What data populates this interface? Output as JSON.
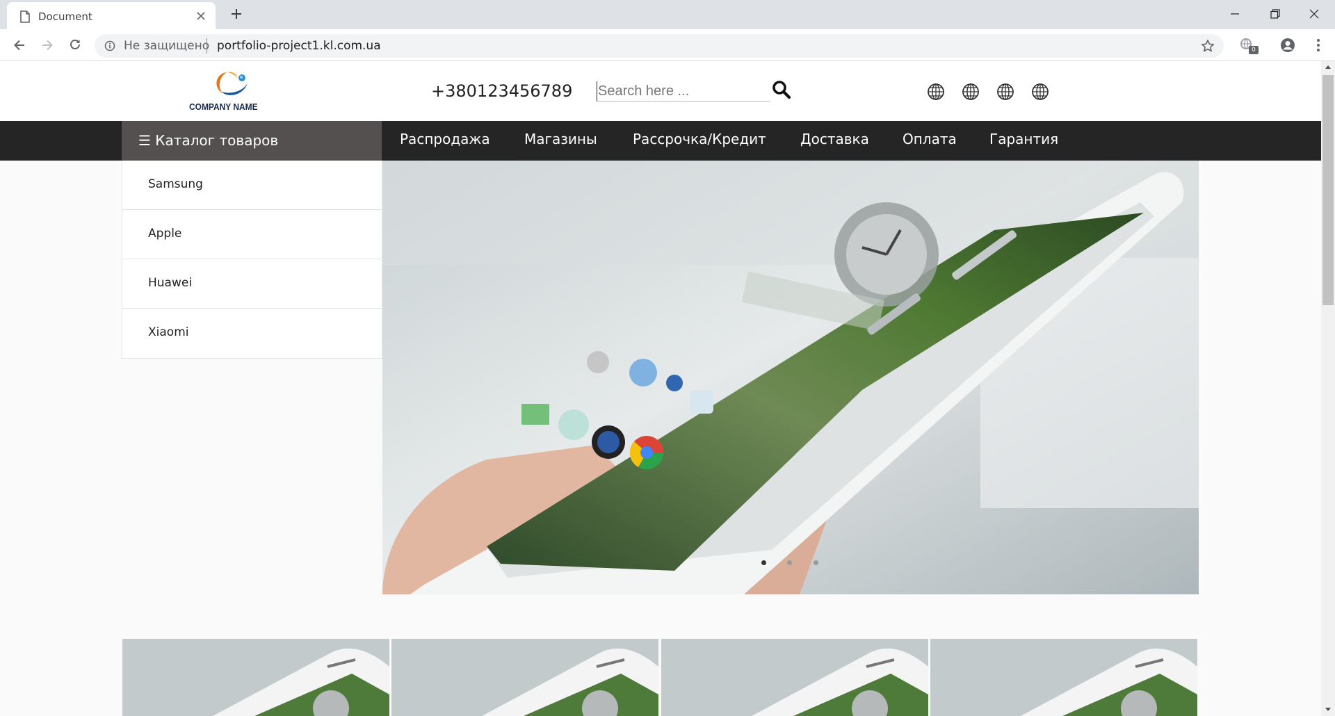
{
  "browser": {
    "tab_title": "Document",
    "security_text": "Не защищено",
    "url": "portfolio-project1.kl.com.ua",
    "extension_badge": "0"
  },
  "site": {
    "logo_text": "COMPANY NAME",
    "phone": "+380123456789",
    "search_placeholder": "Search here ..."
  },
  "nav": {
    "catalog_label": "☰ Каталог товаров",
    "links": [
      "Распродажа",
      "Магазины",
      "Рассрочка/Кредит",
      "Доставка",
      "Оплата",
      "Гарантия"
    ]
  },
  "sidebar": {
    "items": [
      "Samsung",
      "Apple",
      "Huawei",
      "Xiaomi"
    ]
  },
  "slider": {
    "dots": 3,
    "active_dot": 0
  },
  "colors": {
    "nav_bg": "#252525",
    "catalog_bg": "#545050",
    "page_bg": "#fafafa"
  },
  "icons": [
    "document-icon",
    "close-icon",
    "plus-icon",
    "minimize-icon",
    "restore-icon",
    "back-icon",
    "forward-icon",
    "reload-icon",
    "info-icon",
    "star-icon",
    "extension-icon",
    "account-icon",
    "menu-icon",
    "search-icon",
    "globe-icon"
  ]
}
